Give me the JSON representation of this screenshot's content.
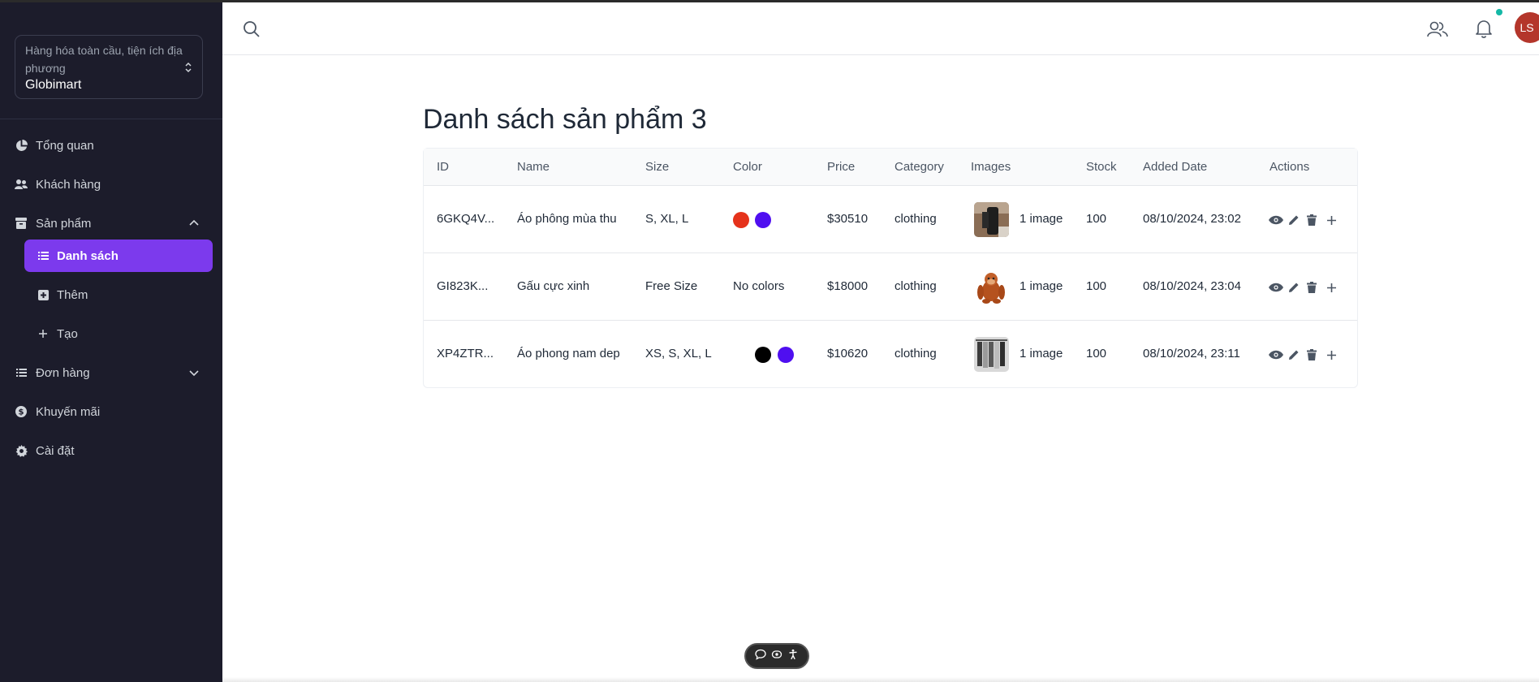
{
  "workspace": {
    "subtitle": "Hàng hóa toàn cầu, tiện ích địa phương",
    "name": "Globimart"
  },
  "sidebar": {
    "items": [
      {
        "label": "Tổng quan",
        "icon": "pie-chart-icon"
      },
      {
        "label": "Khách hàng",
        "icon": "users-icon"
      },
      {
        "label": "Sản phẩm",
        "icon": "archive-icon",
        "expanded": true
      },
      {
        "label": "Danh sách",
        "icon": "list-icon",
        "active": true
      },
      {
        "label": "Thêm",
        "icon": "plus-square-icon"
      },
      {
        "label": "Tạo",
        "icon": "plus-icon"
      },
      {
        "label": "Đơn hàng",
        "icon": "list-icon",
        "expanded": false
      },
      {
        "label": "Khuyến mãi",
        "icon": "dollar-circle-icon"
      },
      {
        "label": "Cài đặt",
        "icon": "gear-icon"
      }
    ]
  },
  "topbar": {
    "avatar_initials": "LS"
  },
  "page": {
    "title": "Danh sách sản phẩm 3"
  },
  "table": {
    "columns": [
      "ID",
      "Name",
      "Size",
      "Color",
      "Price",
      "Category",
      "Images",
      "Stock",
      "Added Date",
      "Actions"
    ],
    "rows": [
      {
        "id": "6GKQ4V...",
        "name": "Áo phông mùa thu",
        "size": "S, XL, L",
        "colors": [
          "#e5321b",
          "#4f0ff0"
        ],
        "color_text": "",
        "price": "$30510",
        "category": "clothing",
        "images": "1 image",
        "stock": "100",
        "added": "08/10/2024, 23:02"
      },
      {
        "id": "GI823K...",
        "name": "Gấu cực xinh",
        "size": "Free Size",
        "colors": [],
        "color_text": "No colors",
        "price": "$18000",
        "category": "clothing",
        "images": "1 image",
        "stock": "100",
        "added": "08/10/2024, 23:04"
      },
      {
        "id": "XP4ZTR...",
        "name": "Áo phong nam dep",
        "size": "XS, S, XL, L",
        "colors": [
          "#000000",
          "#4f0ff0"
        ],
        "color_text": "",
        "price": "$10620",
        "category": "clothing",
        "images": "1 image",
        "stock": "100",
        "added": "08/10/2024, 23:11"
      }
    ]
  },
  "colors": {
    "accent": "#7c3aed",
    "sidebar_bg": "#1c1c2b",
    "avatar_bg": "#b4362b",
    "notif_dot": "#14b8a6"
  }
}
